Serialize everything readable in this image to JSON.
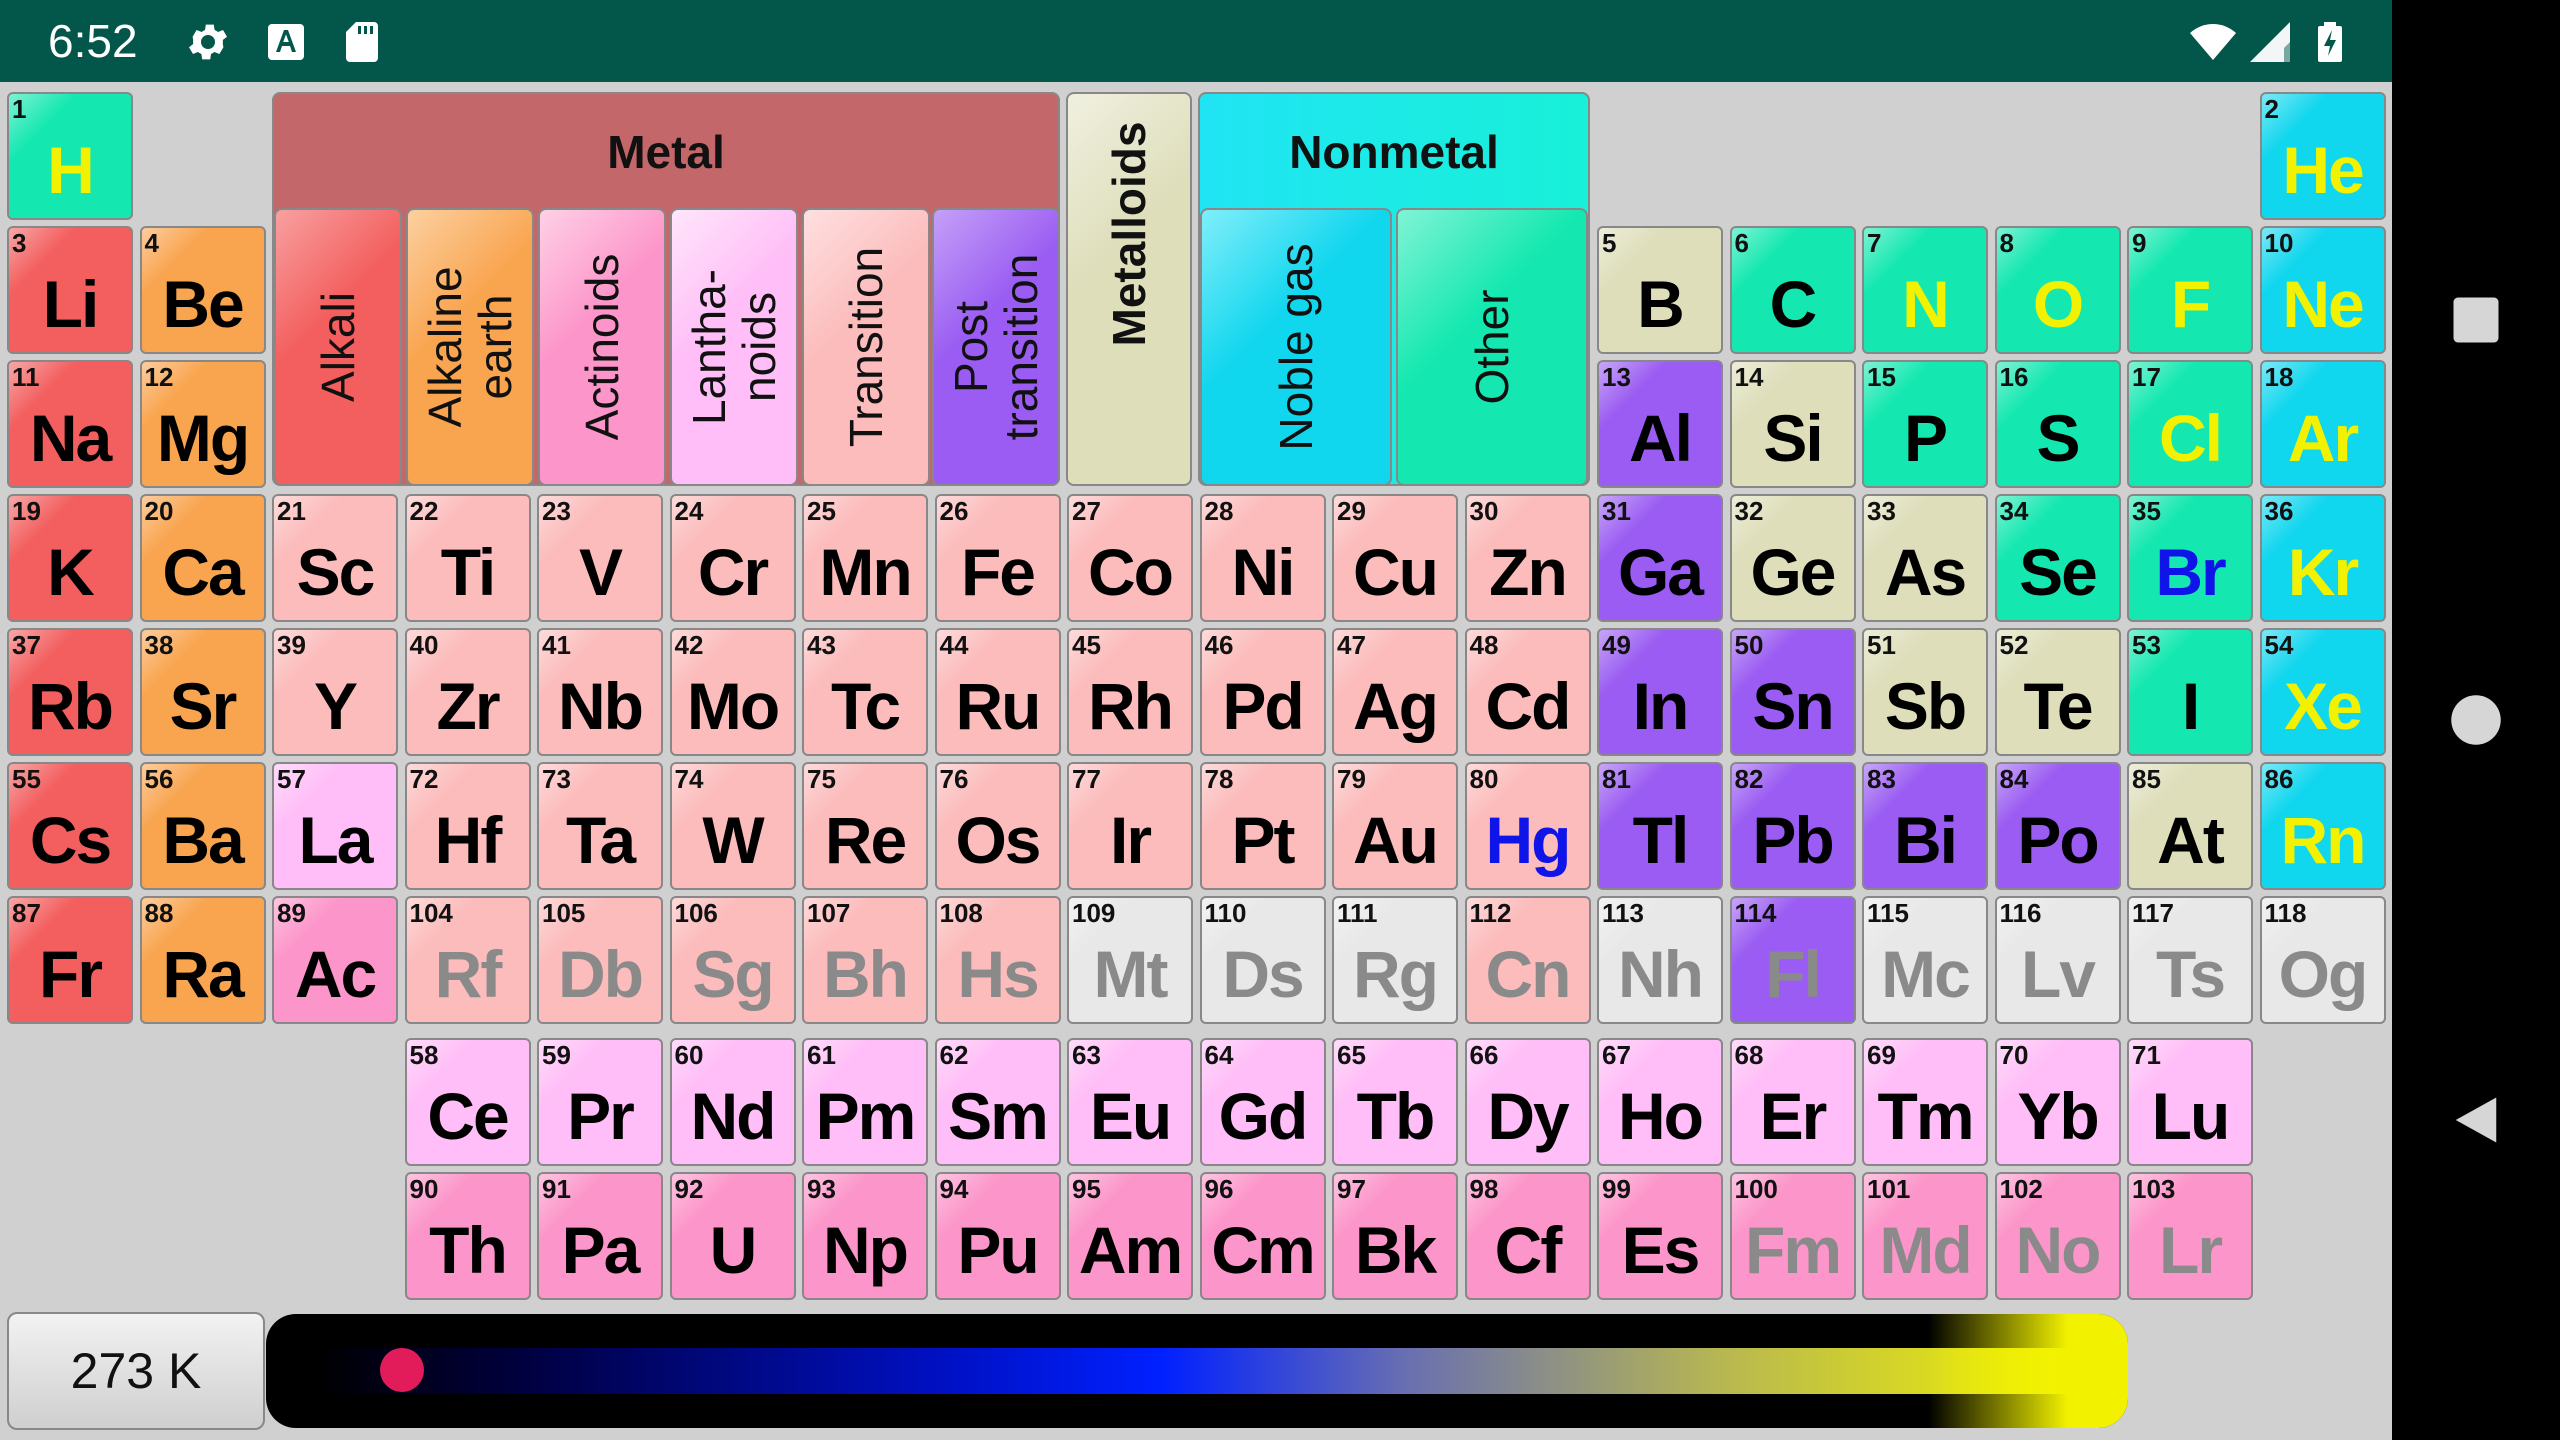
{
  "status_bar": {
    "time": "6:52",
    "left_icons": [
      "gear-icon",
      "font-a-icon",
      "sd-card-icon"
    ],
    "right_icons": [
      "wifi-icon",
      "signal-icon",
      "battery-charging-icon"
    ]
  },
  "nav_bar": {
    "buttons": [
      "square-icon",
      "circle-icon",
      "triangle-back-icon"
    ]
  },
  "legend": {
    "metal": "Metal",
    "metalloids": "Metalloids",
    "nonmetal": "Nonmetal",
    "alkali": "Alkali",
    "alkaline_earth": "Alkaline\nearth",
    "actinoids": "Actinoids",
    "lanthanoids": "Lantha-\nnoids",
    "transition": "Transition",
    "post_transition": "Post\ntransition",
    "noble_gas": "Noble gas",
    "other": "Other"
  },
  "category_colors": {
    "alkali": "#f35e5e",
    "alkaline": "#f9a44e",
    "transition": "#fcbcbc",
    "lanthanoid": "#ffbef7",
    "actinoid": "#fc95c9",
    "post": "#9a5cf2",
    "metalloid": "#dedebb",
    "other_nonmetal": "#14e8b0",
    "noble": "#10d6ee",
    "unknown": "#e8e8e8",
    "metal_header": "#c4676a"
  },
  "state_colors": {
    "solid": "#000000",
    "liquid": "#0f14e8",
    "gas": "#f2f200",
    "unknown": "#8a8a8a"
  },
  "elements": [
    {
      "n": "1",
      "s": "H",
      "c": "other_nonmetal",
      "st": "gas",
      "r": 1,
      "col": 1
    },
    {
      "n": "2",
      "s": "He",
      "c": "noble",
      "st": "gas",
      "r": 1,
      "col": 18
    },
    {
      "n": "3",
      "s": "Li",
      "c": "alkali",
      "st": "solid",
      "r": 2,
      "col": 1
    },
    {
      "n": "4",
      "s": "Be",
      "c": "alkaline",
      "st": "solid",
      "r": 2,
      "col": 2
    },
    {
      "n": "5",
      "s": "B",
      "c": "metalloid",
      "st": "solid",
      "r": 2,
      "col": 13
    },
    {
      "n": "6",
      "s": "C",
      "c": "other_nonmetal",
      "st": "solid",
      "r": 2,
      "col": 14
    },
    {
      "n": "7",
      "s": "N",
      "c": "other_nonmetal",
      "st": "gas",
      "r": 2,
      "col": 15
    },
    {
      "n": "8",
      "s": "O",
      "c": "other_nonmetal",
      "st": "gas",
      "r": 2,
      "col": 16
    },
    {
      "n": "9",
      "s": "F",
      "c": "other_nonmetal",
      "st": "gas",
      "r": 2,
      "col": 17
    },
    {
      "n": "10",
      "s": "Ne",
      "c": "noble",
      "st": "gas",
      "r": 2,
      "col": 18
    },
    {
      "n": "11",
      "s": "Na",
      "c": "alkali",
      "st": "solid",
      "r": 3,
      "col": 1
    },
    {
      "n": "12",
      "s": "Mg",
      "c": "alkaline",
      "st": "solid",
      "r": 3,
      "col": 2
    },
    {
      "n": "13",
      "s": "Al",
      "c": "post",
      "st": "solid",
      "r": 3,
      "col": 13
    },
    {
      "n": "14",
      "s": "Si",
      "c": "metalloid",
      "st": "solid",
      "r": 3,
      "col": 14
    },
    {
      "n": "15",
      "s": "P",
      "c": "other_nonmetal",
      "st": "solid",
      "r": 3,
      "col": 15
    },
    {
      "n": "16",
      "s": "S",
      "c": "other_nonmetal",
      "st": "solid",
      "r": 3,
      "col": 16
    },
    {
      "n": "17",
      "s": "Cl",
      "c": "other_nonmetal",
      "st": "gas",
      "r": 3,
      "col": 17
    },
    {
      "n": "18",
      "s": "Ar",
      "c": "noble",
      "st": "gas",
      "r": 3,
      "col": 18
    },
    {
      "n": "19",
      "s": "K",
      "c": "alkali",
      "st": "solid",
      "r": 4,
      "col": 1
    },
    {
      "n": "20",
      "s": "Ca",
      "c": "alkaline",
      "st": "solid",
      "r": 4,
      "col": 2
    },
    {
      "n": "21",
      "s": "Sc",
      "c": "transition",
      "st": "solid",
      "r": 4,
      "col": 3
    },
    {
      "n": "22",
      "s": "Ti",
      "c": "transition",
      "st": "solid",
      "r": 4,
      "col": 4
    },
    {
      "n": "23",
      "s": "V",
      "c": "transition",
      "st": "solid",
      "r": 4,
      "col": 5
    },
    {
      "n": "24",
      "s": "Cr",
      "c": "transition",
      "st": "solid",
      "r": 4,
      "col": 6
    },
    {
      "n": "25",
      "s": "Mn",
      "c": "transition",
      "st": "solid",
      "r": 4,
      "col": 7
    },
    {
      "n": "26",
      "s": "Fe",
      "c": "transition",
      "st": "solid",
      "r": 4,
      "col": 8
    },
    {
      "n": "27",
      "s": "Co",
      "c": "transition",
      "st": "solid",
      "r": 4,
      "col": 9
    },
    {
      "n": "28",
      "s": "Ni",
      "c": "transition",
      "st": "solid",
      "r": 4,
      "col": 10
    },
    {
      "n": "29",
      "s": "Cu",
      "c": "transition",
      "st": "solid",
      "r": 4,
      "col": 11
    },
    {
      "n": "30",
      "s": "Zn",
      "c": "transition",
      "st": "solid",
      "r": 4,
      "col": 12
    },
    {
      "n": "31",
      "s": "Ga",
      "c": "post",
      "st": "solid",
      "r": 4,
      "col": 13
    },
    {
      "n": "32",
      "s": "Ge",
      "c": "metalloid",
      "st": "solid",
      "r": 4,
      "col": 14
    },
    {
      "n": "33",
      "s": "As",
      "c": "metalloid",
      "st": "solid",
      "r": 4,
      "col": 15
    },
    {
      "n": "34",
      "s": "Se",
      "c": "other_nonmetal",
      "st": "solid",
      "r": 4,
      "col": 16
    },
    {
      "n": "35",
      "s": "Br",
      "c": "other_nonmetal",
      "st": "liquid",
      "r": 4,
      "col": 17
    },
    {
      "n": "36",
      "s": "Kr",
      "c": "noble",
      "st": "gas",
      "r": 4,
      "col": 18
    },
    {
      "n": "37",
      "s": "Rb",
      "c": "alkali",
      "st": "solid",
      "r": 5,
      "col": 1
    },
    {
      "n": "38",
      "s": "Sr",
      "c": "alkaline",
      "st": "solid",
      "r": 5,
      "col": 2
    },
    {
      "n": "39",
      "s": "Y",
      "c": "transition",
      "st": "solid",
      "r": 5,
      "col": 3
    },
    {
      "n": "40",
      "s": "Zr",
      "c": "transition",
      "st": "solid",
      "r": 5,
      "col": 4
    },
    {
      "n": "41",
      "s": "Nb",
      "c": "transition",
      "st": "solid",
      "r": 5,
      "col": 5
    },
    {
      "n": "42",
      "s": "Mo",
      "c": "transition",
      "st": "solid",
      "r": 5,
      "col": 6
    },
    {
      "n": "43",
      "s": "Tc",
      "c": "transition",
      "st": "solid",
      "r": 5,
      "col": 7
    },
    {
      "n": "44",
      "s": "Ru",
      "c": "transition",
      "st": "solid",
      "r": 5,
      "col": 8
    },
    {
      "n": "45",
      "s": "Rh",
      "c": "transition",
      "st": "solid",
      "r": 5,
      "col": 9
    },
    {
      "n": "46",
      "s": "Pd",
      "c": "transition",
      "st": "solid",
      "r": 5,
      "col": 10
    },
    {
      "n": "47",
      "s": "Ag",
      "c": "transition",
      "st": "solid",
      "r": 5,
      "col": 11
    },
    {
      "n": "48",
      "s": "Cd",
      "c": "transition",
      "st": "solid",
      "r": 5,
      "col": 12
    },
    {
      "n": "49",
      "s": "In",
      "c": "post",
      "st": "solid",
      "r": 5,
      "col": 13
    },
    {
      "n": "50",
      "s": "Sn",
      "c": "post",
      "st": "solid",
      "r": 5,
      "col": 14
    },
    {
      "n": "51",
      "s": "Sb",
      "c": "metalloid",
      "st": "solid",
      "r": 5,
      "col": 15
    },
    {
      "n": "52",
      "s": "Te",
      "c": "metalloid",
      "st": "solid",
      "r": 5,
      "col": 16
    },
    {
      "n": "53",
      "s": "I",
      "c": "other_nonmetal",
      "st": "solid",
      "r": 5,
      "col": 17
    },
    {
      "n": "54",
      "s": "Xe",
      "c": "noble",
      "st": "gas",
      "r": 5,
      "col": 18
    },
    {
      "n": "55",
      "s": "Cs",
      "c": "alkali",
      "st": "solid",
      "r": 6,
      "col": 1
    },
    {
      "n": "56",
      "s": "Ba",
      "c": "alkaline",
      "st": "solid",
      "r": 6,
      "col": 2
    },
    {
      "n": "57",
      "s": "La",
      "c": "lanthanoid",
      "st": "solid",
      "r": 6,
      "col": 3
    },
    {
      "n": "72",
      "s": "Hf",
      "c": "transition",
      "st": "solid",
      "r": 6,
      "col": 4
    },
    {
      "n": "73",
      "s": "Ta",
      "c": "transition",
      "st": "solid",
      "r": 6,
      "col": 5
    },
    {
      "n": "74",
      "s": "W",
      "c": "transition",
      "st": "solid",
      "r": 6,
      "col": 6
    },
    {
      "n": "75",
      "s": "Re",
      "c": "transition",
      "st": "solid",
      "r": 6,
      "col": 7
    },
    {
      "n": "76",
      "s": "Os",
      "c": "transition",
      "st": "solid",
      "r": 6,
      "col": 8
    },
    {
      "n": "77",
      "s": "Ir",
      "c": "transition",
      "st": "solid",
      "r": 6,
      "col": 9
    },
    {
      "n": "78",
      "s": "Pt",
      "c": "transition",
      "st": "solid",
      "r": 6,
      "col": 10
    },
    {
      "n": "79",
      "s": "Au",
      "c": "transition",
      "st": "solid",
      "r": 6,
      "col": 11
    },
    {
      "n": "80",
      "s": "Hg",
      "c": "transition",
      "st": "liquid",
      "r": 6,
      "col": 12
    },
    {
      "n": "81",
      "s": "Tl",
      "c": "post",
      "st": "solid",
      "r": 6,
      "col": 13
    },
    {
      "n": "82",
      "s": "Pb",
      "c": "post",
      "st": "solid",
      "r": 6,
      "col": 14
    },
    {
      "n": "83",
      "s": "Bi",
      "c": "post",
      "st": "solid",
      "r": 6,
      "col": 15
    },
    {
      "n": "84",
      "s": "Po",
      "c": "post",
      "st": "solid",
      "r": 6,
      "col": 16
    },
    {
      "n": "85",
      "s": "At",
      "c": "metalloid",
      "st": "solid",
      "r": 6,
      "col": 17
    },
    {
      "n": "86",
      "s": "Rn",
      "c": "noble",
      "st": "gas",
      "r": 6,
      "col": 18
    },
    {
      "n": "87",
      "s": "Fr",
      "c": "alkali",
      "st": "solid",
      "r": 7,
      "col": 1
    },
    {
      "n": "88",
      "s": "Ra",
      "c": "alkaline",
      "st": "solid",
      "r": 7,
      "col": 2
    },
    {
      "n": "89",
      "s": "Ac",
      "c": "actinoid",
      "st": "solid",
      "r": 7,
      "col": 3
    },
    {
      "n": "104",
      "s": "Rf",
      "c": "transition",
      "st": "unknown",
      "r": 7,
      "col": 4
    },
    {
      "n": "105",
      "s": "Db",
      "c": "transition",
      "st": "unknown",
      "r": 7,
      "col": 5
    },
    {
      "n": "106",
      "s": "Sg",
      "c": "transition",
      "st": "unknown",
      "r": 7,
      "col": 6
    },
    {
      "n": "107",
      "s": "Bh",
      "c": "transition",
      "st": "unknown",
      "r": 7,
      "col": 7
    },
    {
      "n": "108",
      "s": "Hs",
      "c": "transition",
      "st": "unknown",
      "r": 7,
      "col": 8
    },
    {
      "n": "109",
      "s": "Mt",
      "c": "unknown",
      "st": "unknown",
      "r": 7,
      "col": 9
    },
    {
      "n": "110",
      "s": "Ds",
      "c": "unknown",
      "st": "unknown",
      "r": 7,
      "col": 10
    },
    {
      "n": "111",
      "s": "Rg",
      "c": "unknown",
      "st": "unknown",
      "r": 7,
      "col": 11
    },
    {
      "n": "112",
      "s": "Cn",
      "c": "transition",
      "st": "unknown",
      "r": 7,
      "col": 12
    },
    {
      "n": "113",
      "s": "Nh",
      "c": "unknown",
      "st": "unknown",
      "r": 7,
      "col": 13
    },
    {
      "n": "114",
      "s": "Fl",
      "c": "post",
      "st": "unknown",
      "r": 7,
      "col": 14
    },
    {
      "n": "115",
      "s": "Mc",
      "c": "unknown",
      "st": "unknown",
      "r": 7,
      "col": 15
    },
    {
      "n": "116",
      "s": "Lv",
      "c": "unknown",
      "st": "unknown",
      "r": 7,
      "col": 16
    },
    {
      "n": "117",
      "s": "Ts",
      "c": "unknown",
      "st": "unknown",
      "r": 7,
      "col": 17
    },
    {
      "n": "118",
      "s": "Og",
      "c": "unknown",
      "st": "unknown",
      "r": 7,
      "col": 18
    },
    {
      "n": "58",
      "s": "Ce",
      "c": "lanthanoid",
      "st": "solid",
      "r": 8,
      "col": 4
    },
    {
      "n": "59",
      "s": "Pr",
      "c": "lanthanoid",
      "st": "solid",
      "r": 8,
      "col": 5
    },
    {
      "n": "60",
      "s": "Nd",
      "c": "lanthanoid",
      "st": "solid",
      "r": 8,
      "col": 6
    },
    {
      "n": "61",
      "s": "Pm",
      "c": "lanthanoid",
      "st": "solid",
      "r": 8,
      "col": 7
    },
    {
      "n": "62",
      "s": "Sm",
      "c": "lanthanoid",
      "st": "solid",
      "r": 8,
      "col": 8
    },
    {
      "n": "63",
      "s": "Eu",
      "c": "lanthanoid",
      "st": "solid",
      "r": 8,
      "col": 9
    },
    {
      "n": "64",
      "s": "Gd",
      "c": "lanthanoid",
      "st": "solid",
      "r": 8,
      "col": 10
    },
    {
      "n": "65",
      "s": "Tb",
      "c": "lanthanoid",
      "st": "solid",
      "r": 8,
      "col": 11
    },
    {
      "n": "66",
      "s": "Dy",
      "c": "lanthanoid",
      "st": "solid",
      "r": 8,
      "col": 12
    },
    {
      "n": "67",
      "s": "Ho",
      "c": "lanthanoid",
      "st": "solid",
      "r": 8,
      "col": 13
    },
    {
      "n": "68",
      "s": "Er",
      "c": "lanthanoid",
      "st": "solid",
      "r": 8,
      "col": 14
    },
    {
      "n": "69",
      "s": "Tm",
      "c": "lanthanoid",
      "st": "solid",
      "r": 8,
      "col": 15
    },
    {
      "n": "70",
      "s": "Yb",
      "c": "lanthanoid",
      "st": "solid",
      "r": 8,
      "col": 16
    },
    {
      "n": "71",
      "s": "Lu",
      "c": "lanthanoid",
      "st": "solid",
      "r": 8,
      "col": 17
    },
    {
      "n": "90",
      "s": "Th",
      "c": "actinoid",
      "st": "solid",
      "r": 9,
      "col": 4
    },
    {
      "n": "91",
      "s": "Pa",
      "c": "actinoid",
      "st": "solid",
      "r": 9,
      "col": 5
    },
    {
      "n": "92",
      "s": "U",
      "c": "actinoid",
      "st": "solid",
      "r": 9,
      "col": 6
    },
    {
      "n": "93",
      "s": "Np",
      "c": "actinoid",
      "st": "solid",
      "r": 9,
      "col": 7
    },
    {
      "n": "94",
      "s": "Pu",
      "c": "actinoid",
      "st": "solid",
      "r": 9,
      "col": 8
    },
    {
      "n": "95",
      "s": "Am",
      "c": "actinoid",
      "st": "solid",
      "r": 9,
      "col": 9
    },
    {
      "n": "96",
      "s": "Cm",
      "c": "actinoid",
      "st": "solid",
      "r": 9,
      "col": 10
    },
    {
      "n": "97",
      "s": "Bk",
      "c": "actinoid",
      "st": "solid",
      "r": 9,
      "col": 11
    },
    {
      "n": "98",
      "s": "Cf",
      "c": "actinoid",
      "st": "solid",
      "r": 9,
      "col": 12
    },
    {
      "n": "99",
      "s": "Es",
      "c": "actinoid",
      "st": "solid",
      "r": 9,
      "col": 13
    },
    {
      "n": "100",
      "s": "Fm",
      "c": "actinoid",
      "st": "unknown",
      "r": 9,
      "col": 14
    },
    {
      "n": "101",
      "s": "Md",
      "c": "actinoid",
      "st": "unknown",
      "r": 9,
      "col": 15
    },
    {
      "n": "102",
      "s": "No",
      "c": "actinoid",
      "st": "unknown",
      "r": 9,
      "col": 16
    },
    {
      "n": "103",
      "s": "Lr",
      "c": "actinoid",
      "st": "unknown",
      "r": 9,
      "col": 17
    }
  ],
  "temperature": {
    "label": "273 K",
    "slider_fraction": 0.05
  }
}
